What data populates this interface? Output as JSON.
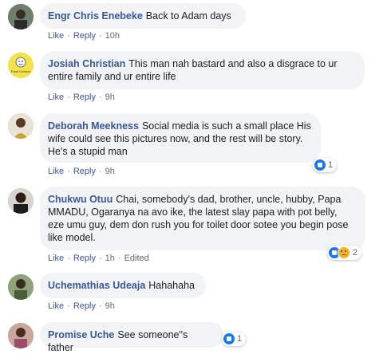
{
  "actions": {
    "like": "Like",
    "reply": "Reply",
    "edited": "Edited",
    "sep": "·"
  },
  "comments": [
    {
      "author": "Engr Chris Enebeke",
      "text": "Back to Adam days",
      "time": "10h"
    },
    {
      "author": "Josiah Christian",
      "text": "This man nah bastard and also a disgrace to ur entire family and ur entire life",
      "time": "9h",
      "avatar_text": "Face Contact"
    },
    {
      "author": "Deborah Meekness",
      "text": "Social media is such a small place His wife could see this pictures now, and the rest will be story. He's a stupid man",
      "time": "9h",
      "reactions": {
        "count": "1",
        "types": [
          "like-icon"
        ]
      }
    },
    {
      "author": "Chukwu Otuu",
      "text": "Chai, somebody's dad, brother, uncle, hubby, Papa MMADU, Ogaranya na avo ike, the latest slay papa with pot belly, eze umu guy, dem don rush you for toilet door sotee you begin pose like model.",
      "time": "1h",
      "edited": true,
      "reactions": {
        "count": "2",
        "types": [
          "like-icon",
          "sad-icon"
        ]
      }
    },
    {
      "author": "Uchemathias Udeaja",
      "text": "Hahahaha",
      "time": "9h"
    },
    {
      "author": "Promise Uche",
      "text": "See someone\"s father",
      "reactions": {
        "count": "1",
        "types": [
          "like-icon"
        ]
      }
    }
  ],
  "colors": {
    "link": "#385898",
    "bubble": "#f2f3f5",
    "meta": "#606770",
    "like": "#1877f2"
  }
}
